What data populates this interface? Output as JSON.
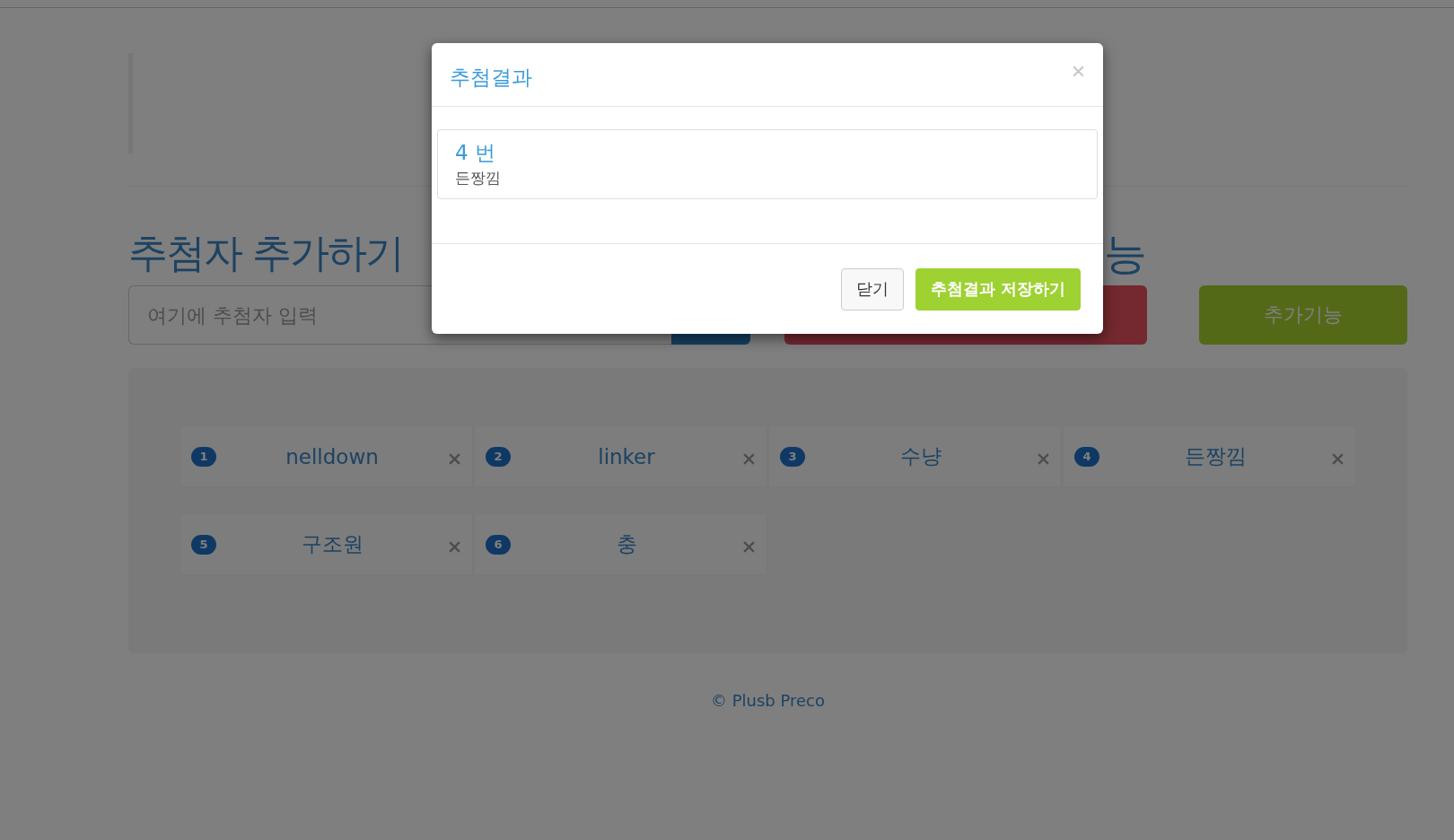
{
  "page": {
    "heading": "추첨자 추가하기",
    "heading_fragment": "능",
    "input": {
      "placeholder": "여기에 추첨자 입력"
    },
    "extra_button": "추가기능",
    "entries": [
      {
        "number": "1",
        "name": "nelldown"
      },
      {
        "number": "2",
        "name": "linker"
      },
      {
        "number": "3",
        "name": "수냥"
      },
      {
        "number": "4",
        "name": "든짱낌"
      },
      {
        "number": "5",
        "name": "구조원"
      },
      {
        "number": "6",
        "name": "충"
      }
    ],
    "footer": "© Plusb Preco"
  },
  "modal": {
    "title": "추첨결과",
    "result": {
      "number": "4 번",
      "name": "든짱낌"
    },
    "buttons": [
      {
        "label": "닫기",
        "kind": "default"
      },
      {
        "label": "추첨결과 저장하기",
        "kind": "primary"
      }
    ]
  }
}
